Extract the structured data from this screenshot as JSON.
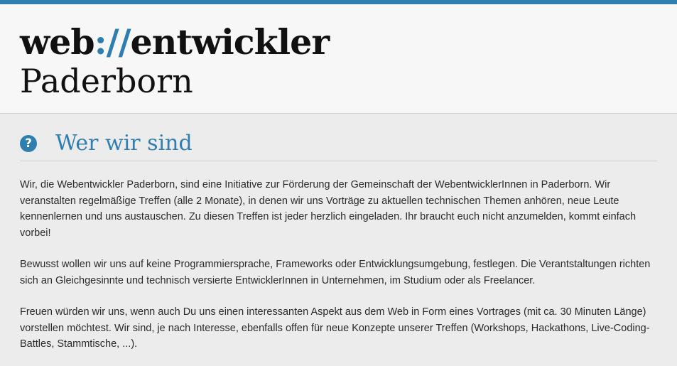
{
  "header": {
    "logo_part1": "web",
    "logo_accent": "://",
    "logo_part2": "entwickler",
    "logo_city": "Paderborn"
  },
  "section": {
    "icon": "question-circle-icon",
    "title": "Wer wir sind",
    "paragraphs": [
      "Wir, die Webentwickler Paderborn, sind eine Initiative zur Förderung der Gemeinschaft der WebentwicklerInnen in Paderborn. Wir veranstalten regelmäßige Treffen (alle 2 Monate), in denen wir uns Vorträge zu aktuellen technischen Themen anhören, neue Leute kennenlernen und uns austauschen. Zu diesen Treffen ist jeder herzlich eingeladen. Ihr braucht euch nicht anzumelden, kommt einfach vorbei!",
      "Bewusst wollen wir uns auf keine Programmiersprache, Frameworks oder Entwicklungsumgebung, festlegen. Die Verantstaltungen richten sich an Gleichgesinnte und technisch versierte EntwicklerInnen in Unternehmen, im Studium oder als Freelancer.",
      "Freuen würden wir uns, wenn auch Du uns einen interessanten Aspekt aus dem Web in Form eines Vortrages (mit ca. 30 Minuten Länge) vorstellen möchtest. Wir sind, je nach Interesse, ebenfalls offen für neue Konzepte unserer Treffen (Workshops, Hackathons, Live-Coding-Battles, Stammtische, ...)."
    ]
  },
  "colors": {
    "accent": "#2e7fb0",
    "background": "#ececec",
    "header_background": "#f7f7f7",
    "text": "#2a2a2a"
  }
}
